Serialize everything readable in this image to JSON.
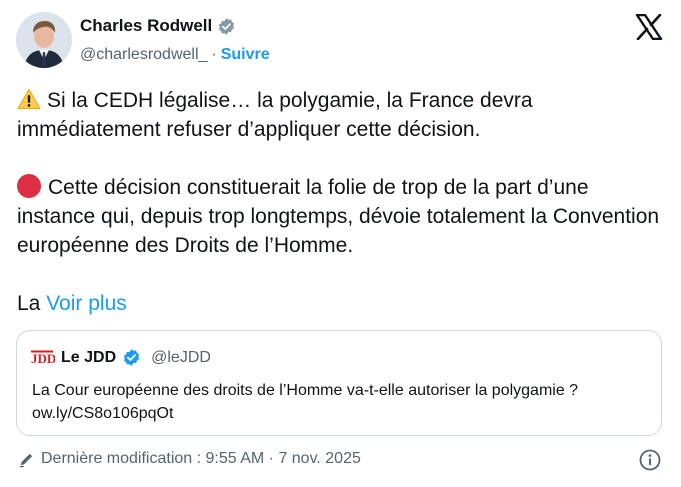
{
  "author": {
    "name": "Charles Rodwell",
    "handle": "@charlesrodwell_",
    "separator": "·",
    "follow_label": "Suivre"
  },
  "tweet": {
    "paragraph1": "Si la CEDH légalise… la polygamie, la France devra immédiatement refuser d’appliquer cette décision.",
    "paragraph2": "Cette décision constituerait la folie de trop de la part d’une instance qui, depuis trop longtemps, dévoie totalement la Convention européenne des Droits de l’Homme.",
    "truncated_start": "La",
    "show_more_label": "Voir plus"
  },
  "quote": {
    "logo_text": "JDD",
    "name": "Le JDD",
    "handle": "@leJDD",
    "text_line1": "La Cour européenne des droits de l’Homme va-t-elle autoriser la polygamie ?",
    "text_line2": "ow.ly/CS8o106pqOt"
  },
  "footer": {
    "edited_text": "Dernière modification : 9:55 AM · 7 nov. 2025"
  },
  "colors": {
    "accent": "#1d9bf0",
    "muted": "#536471",
    "text": "#0f1419",
    "border": "#cfd9de",
    "jdd_red": "#d21f26"
  },
  "icons": [
    "verified-badge-icon",
    "x-logo-icon",
    "warning-emoji-icon",
    "red-circle-emoji-icon",
    "jdd-logo-icon",
    "pencil-icon",
    "info-icon"
  ]
}
